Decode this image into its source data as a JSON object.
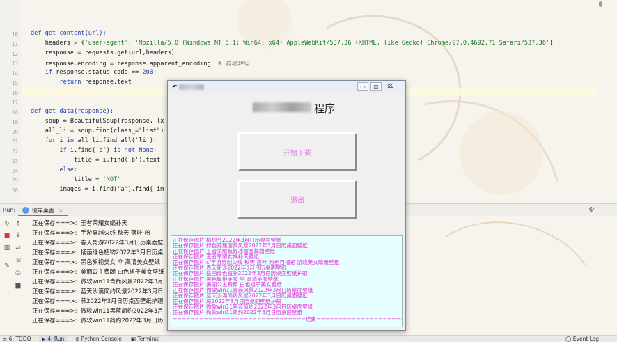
{
  "colors": {
    "accent": "#4a7fd8",
    "log_text": "#e02ed0",
    "log_bg": "#e8ffff",
    "keyword": "#1f3fa8",
    "string": "#1c7a2a"
  },
  "gutter": {
    "line_numbers": [
      "10",
      "11",
      "12",
      "13",
      "14",
      "15",
      "16",
      "17",
      "18",
      "19",
      "20",
      "21",
      "22",
      "23",
      "24",
      "25",
      "26"
    ]
  },
  "editor": {
    "line_10": "def get_content(url):",
    "line_11_pre": "    headers = {",
    "line_11_str": "'user-agent': 'Mozilla/5.0 (Windows NT 6.1; Win64; x64) AppleWebKit/537.36 (KHTML, like Gecko) Chrome/97.0.4692.71 Safari/537.36'",
    "line_11_post": "}",
    "line_12": "    response = requests.get(url,headers)",
    "line_13_code": "    response.encoding = response.apparent_encoding  ",
    "line_13_cmt": "# 自动转码",
    "line_14_kw": "    if",
    "line_14_code": " response.status_code == ",
    "line_14_num": "200",
    "line_14_end": ":",
    "line_15_kw": "        return",
    "line_15_code": " response.text",
    "line_18": "def get_data(response):",
    "line_19": "    soup = BeautifulSoup(response,'lx",
    "line_20": "    all_li = soup.find(class_=\"list\")",
    "line_21_kw": "    for",
    "line_21_code": " i ",
    "line_21_kw2": "in",
    "line_21_code2": " all_li.find_all('li'):",
    "line_22_kw": "        if",
    "line_22_code": " i.find('b') ",
    "line_22_kw2": "is not None",
    "line_22_end": ":",
    "line_23": "            title = i.find('b').text",
    "line_24_kw": "        else",
    "line_24_end": ":",
    "line_25_code": "            title = ",
    "line_25_str": "'NOT'",
    "line_26": "        images = i.find('a').find('im"
  },
  "run_panel": {
    "run_label": "Run:",
    "tab_label": "彼岸桌面",
    "tab_close": "×",
    "gear": "⚙",
    "minimize": "—",
    "output": [
      {
        "prefix": "正在保存===>:",
        "text": "王者荣耀女娲补天"
      },
      {
        "prefix": "正在保存===>:",
        "text": "手游穿越火线 秋天 落叶 粉"
      },
      {
        "prefix": "正在保存===>:",
        "text": "春天哥游2022年3月日历桌面壁"
      },
      {
        "prefix": "正在保存===>:",
        "text": "插画绿色植物2022年3月日历桌"
      },
      {
        "prefix": "正在保存===>:",
        "text": "黑色旗袍美女 伞 高清美女壁纸"
      },
      {
        "prefix": "正在保存===>:",
        "text": "美丽公主费朗 白色裙子美女壁纸"
      },
      {
        "prefix": "正在保存===>:",
        "text": "微软win11青箭风景2022年3月"
      },
      {
        "prefix": "正在保存===>:",
        "text": "蓝天沙漠简约风景2022年3月日"
      },
      {
        "prefix": "正在保存===>:",
        "text": "蕨2022年3月日历桌面壁纸护眼"
      },
      {
        "prefix": "正在保存===>:",
        "text": "微软win11黑蓝简约2022年3月"
      },
      {
        "prefix": "正在保存===>:",
        "text": "微软win11简约2022年3月日历"
      }
    ]
  },
  "status_bar": {
    "todo": "≡ 6: TODO",
    "run": "▶ 4: Run",
    "console": "⊕ Python Console",
    "terminal": "▣ Terminal",
    "event_log": "◯ Event Log"
  },
  "tk_window": {
    "title_icon": "✒",
    "min_label": "▭",
    "max_label": "◫",
    "close_label": "⌧",
    "heading": "程序",
    "start_button": "开始下载",
    "exit_button": "退出",
    "log": [
      "正在保存图片:植树节2022年3月日历桌面壁纸",
      "正在保存图片:绿色锦簇菌景风景2022年3月日历桌面壁纸",
      "正在保存图片:王者荣耀甄姬冰雪圆舞曲壁纸",
      "正在保存图片:王者荣耀女娲补天壁纸",
      "正在保存图片:cf手游穿越火线 秋天 落叶 粉色百褶裙 游戏美女晴雅壁纸",
      "正在保存图片:春天哥游2022年3月日历桌面壁纸",
      "正在保存图片:插画绿色植物2022年3月日历桌面壁纸护眼",
      "正在保存图片:黑色旗袍美女 伞 高清美女壁纸",
      "正在保存图片:美丽公主费朗 白色裙子美女壁纸",
      "正在保存图片:微软win11青箭风景2022年3月日历桌面壁纸",
      "正在保存图片:蓝天沙漠简约风景2022年3月日历桌面壁纸",
      "正在保存图片:蕨2022年3月日历桌面壁纸护眼",
      "正在保存图片:微软win11黑蓝简约2022年3月日历桌面壁纸",
      "正在保存图片:微软win11简约2022年3月日历桌面壁纸"
    ],
    "log_end": "==============================结束=============================="
  }
}
